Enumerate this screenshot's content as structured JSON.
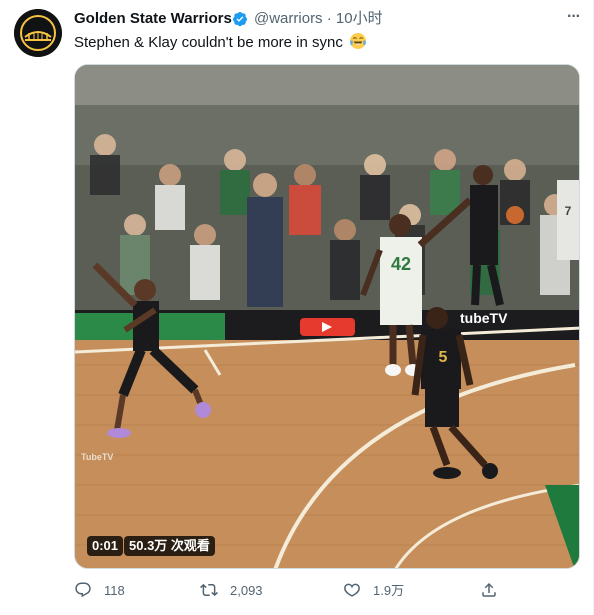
{
  "tweet": {
    "author_name": "Golden State Warriors",
    "handle": "@warriors",
    "separator": "·",
    "time": "10小时",
    "text": "Stephen & Klay couldn't be more in sync",
    "emoji": "face-with-tears-of-joy"
  },
  "media": {
    "duration": "0:01",
    "views": "50.3万 次观看",
    "court_text": "tubeTV",
    "court_text_small": "TubeTV",
    "jersey_green": "42",
    "jersey_black": "5",
    "jersey_back_white": "7"
  },
  "actions": {
    "reply_count": "118",
    "retweet_count": "2,093",
    "like_count": "1.9万"
  },
  "colors": {
    "verified": "#1d9bf0",
    "muted_text": "#536471",
    "text": "#0f1419",
    "court_wood": "#c58e5a",
    "court_green": "#1f7a3d"
  }
}
